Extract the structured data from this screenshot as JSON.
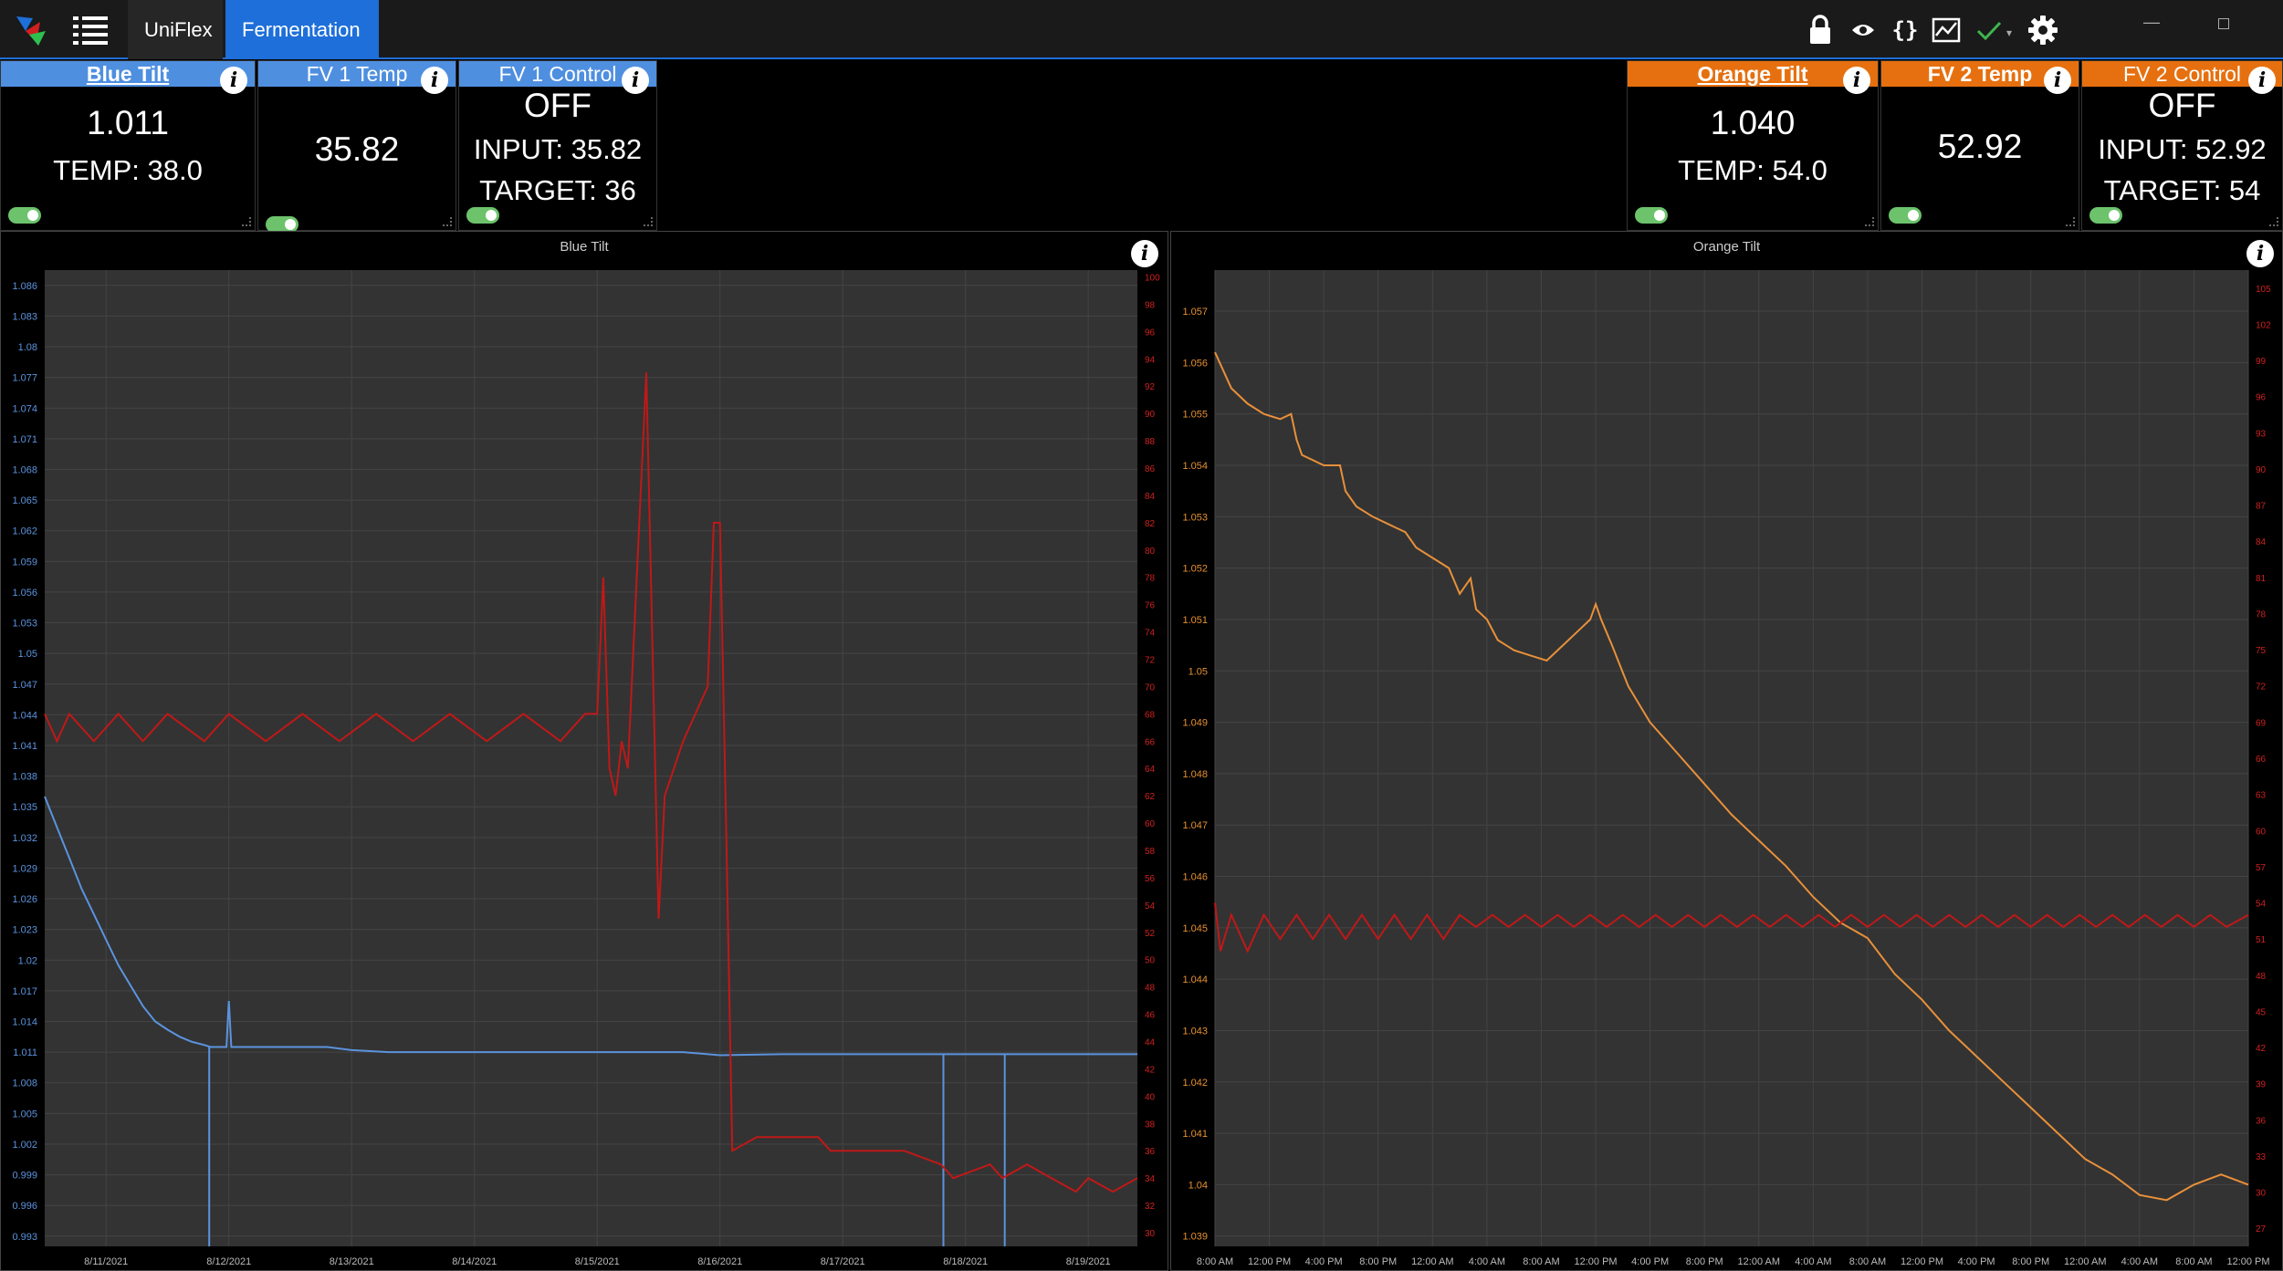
{
  "titlebar": {
    "tabs": [
      {
        "label": "UniFlex",
        "active": false
      },
      {
        "label": "Fermentation",
        "active": true
      }
    ],
    "icons": [
      "lock-icon",
      "eye-icon",
      "braces-icon",
      "chart-icon",
      "check-icon",
      "gear-icon"
    ],
    "window_controls": [
      "minimize",
      "maximize"
    ]
  },
  "tiles": [
    {
      "title": "Blue Tilt",
      "value": "1.011",
      "line2": "TEMP: 38.0",
      "color": "#4f8fe0",
      "enabled": true
    },
    {
      "title": "FV 1 Temp",
      "value": "35.82",
      "color": "#4f8fe0",
      "enabled": true
    },
    {
      "title": "FV 1 Control",
      "value": "OFF",
      "line2": "INPUT: 35.82",
      "line3": "TARGET: 36",
      "color": "#4f8fe0",
      "enabled": true
    },
    {
      "title": "Orange Tilt",
      "value": "1.040",
      "line2": "TEMP: 54.0",
      "color": "#e6700f",
      "enabled": true
    },
    {
      "title": "FV 2 Temp",
      "value": "52.92",
      "color": "#e6700f",
      "enabled": true
    },
    {
      "title": "FV 2 Control",
      "value": "OFF",
      "line2": "INPUT: 52.92",
      "line3": "TARGET: 54",
      "color": "#e6700f",
      "enabled": true
    }
  ],
  "chart_data": [
    {
      "type": "line",
      "title": "Blue Tilt",
      "x_tick_labels": [
        "8/11/2021",
        "8/12/2021",
        "8/13/2021",
        "8/14/2021",
        "8/15/2021",
        "8/16/2021",
        "8/17/2021",
        "8/18/2021",
        "8/19/2021"
      ],
      "y_left_ticks": [
        "1.086",
        "1.083",
        "1.08",
        "1.077",
        "1.074",
        "1.071",
        "1.068",
        "1.065",
        "1.062",
        "1.059",
        "1.056",
        "1.053",
        "1.05",
        "1.047",
        "1.044",
        "1.041",
        "1.038",
        "1.035",
        "1.032",
        "1.029",
        "1.026",
        "1.023",
        "1.02",
        "1.017",
        "1.014",
        "1.011",
        "1.008",
        "1.005",
        "1.002",
        "0.999",
        "0.996",
        "0.993"
      ],
      "y_right_ticks": [
        "100",
        "98",
        "96",
        "94",
        "92",
        "90",
        "88",
        "86",
        "84",
        "82",
        "80",
        "78",
        "76",
        "74",
        "72",
        "70",
        "68",
        "66",
        "64",
        "62",
        "60",
        "58",
        "56",
        "54",
        "52",
        "50",
        "48",
        "46",
        "44",
        "42",
        "40",
        "38",
        "36",
        "34",
        "32",
        "30"
      ],
      "ylim_left": [
        0.992,
        1.0875
      ],
      "ylim_right": [
        29,
        100.5
      ],
      "xlim": [
        10.5,
        19.4
      ],
      "grid": true,
      "series": [
        {
          "axis": "left",
          "color": "#5b93de",
          "points": [
            [
              10.5,
              1.036
            ],
            [
              10.6,
              1.033
            ],
            [
              10.7,
              1.03
            ],
            [
              10.8,
              1.027
            ],
            [
              10.9,
              1.0245
            ],
            [
              11.0,
              1.022
            ],
            [
              11.1,
              1.0195
            ],
            [
              11.2,
              1.0175
            ],
            [
              11.3,
              1.0155
            ],
            [
              11.4,
              1.014
            ],
            [
              11.5,
              1.0132
            ],
            [
              11.6,
              1.0125
            ],
            [
              11.7,
              1.012
            ],
            [
              11.8,
              1.0117
            ],
            [
              11.85,
              1.0115
            ],
            [
              11.9,
              1.0115
            ],
            [
              11.98,
              1.0115
            ],
            [
              12.0,
              1.016
            ],
            [
              12.02,
              1.0115
            ],
            [
              12.5,
              1.0115
            ],
            [
              12.8,
              1.0115
            ],
            [
              13.0,
              1.0112
            ],
            [
              13.3,
              1.011
            ],
            [
              14.0,
              1.011
            ],
            [
              15.0,
              1.011
            ],
            [
              15.7,
              1.011
            ],
            [
              16.0,
              1.0107
            ],
            [
              16.5,
              1.0108
            ],
            [
              17.0,
              1.0108
            ],
            [
              17.5,
              1.0108
            ],
            [
              18.0,
              1.0108
            ],
            [
              18.5,
              1.0108
            ],
            [
              19.0,
              1.0108
            ],
            [
              19.4,
              1.0108
            ]
          ]
        },
        {
          "axis": "left",
          "color": "#5b93de",
          "points": [
            [
              11.84,
              1.0115
            ],
            [
              11.84,
              0.992
            ]
          ]
        },
        {
          "axis": "left",
          "color": "#5b93de",
          "points": [
            [
              17.82,
              1.0108
            ],
            [
              17.82,
              0.992
            ]
          ]
        },
        {
          "axis": "left",
          "color": "#5b93de",
          "points": [
            [
              18.32,
              1.0108
            ],
            [
              18.32,
              0.992
            ]
          ]
        },
        {
          "axis": "right",
          "color": "#c01818",
          "points": [
            [
              10.5,
              68
            ],
            [
              10.6,
              66
            ],
            [
              10.7,
              68
            ],
            [
              10.9,
              66
            ],
            [
              11.1,
              68
            ],
            [
              11.3,
              66
            ],
            [
              11.5,
              68
            ],
            [
              11.8,
              66
            ],
            [
              12.0,
              68
            ],
            [
              12.3,
              66
            ],
            [
              12.6,
              68
            ],
            [
              12.9,
              66
            ],
            [
              13.2,
              68
            ],
            [
              13.5,
              66
            ],
            [
              13.8,
              68
            ],
            [
              14.1,
              66
            ],
            [
              14.4,
              68
            ],
            [
              14.7,
              66
            ],
            [
              14.9,
              68
            ],
            [
              15.0,
              68
            ],
            [
              15.05,
              78
            ],
            [
              15.1,
              64
            ],
            [
              15.15,
              62
            ],
            [
              15.2,
              66
            ],
            [
              15.25,
              64
            ],
            [
              15.4,
              93
            ],
            [
              15.5,
              53
            ],
            [
              15.55,
              62
            ],
            [
              15.7,
              66
            ],
            [
              15.8,
              68
            ],
            [
              15.9,
              70
            ],
            [
              15.95,
              82
            ],
            [
              16.0,
              82
            ],
            [
              16.05,
              60
            ],
            [
              16.1,
              36
            ],
            [
              16.3,
              37
            ],
            [
              16.6,
              37
            ],
            [
              16.8,
              37
            ],
            [
              16.9,
              36
            ],
            [
              17.2,
              36
            ],
            [
              17.5,
              36
            ],
            [
              17.8,
              35
            ],
            [
              17.9,
              34
            ],
            [
              18.2,
              35
            ],
            [
              18.3,
              34
            ],
            [
              18.5,
              35
            ],
            [
              18.7,
              34
            ],
            [
              18.9,
              33
            ],
            [
              19.0,
              34
            ],
            [
              19.2,
              33
            ],
            [
              19.4,
              34
            ]
          ]
        }
      ]
    },
    {
      "type": "line",
      "title": "Orange Tilt",
      "x_tick_labels": [
        "8:00 AM",
        "12:00 PM",
        "4:00 PM",
        "8:00 PM",
        "12:00 AM",
        "4:00 AM",
        "8:00 AM",
        "12:00 PM",
        "4:00 PM",
        "8:00 PM",
        "12:00 AM",
        "4:00 AM",
        "8:00 AM",
        "12:00 PM",
        "4:00 PM",
        "8:00 PM",
        "12:00 AM",
        "4:00 AM",
        "8:00 AM",
        "12:00 PM"
      ],
      "y_left_ticks": [
        "1.057",
        "1.056",
        "1.055",
        "1.054",
        "1.053",
        "1.052",
        "1.051",
        "1.05",
        "1.049",
        "1.048",
        "1.047",
        "1.046",
        "1.045",
        "1.044",
        "1.043",
        "1.042",
        "1.041",
        "1.04",
        "1.039"
      ],
      "y_right_ticks": [
        "105",
        "102",
        "99",
        "96",
        "93",
        "90",
        "87",
        "84",
        "81",
        "78",
        "75",
        "72",
        "69",
        "66",
        "63",
        "60",
        "57",
        "54",
        "51",
        "48",
        "45",
        "42",
        "39",
        "36",
        "33",
        "30",
        "27"
      ],
      "ylim_left": [
        1.0388,
        1.0578
      ],
      "ylim_right": [
        25.5,
        106.5
      ],
      "xlim": [
        0,
        19
      ],
      "grid": true,
      "series": [
        {
          "axis": "left",
          "color": "#e8903a",
          "points": [
            [
              0,
              1.0562
            ],
            [
              0.3,
              1.0555
            ],
            [
              0.6,
              1.0552
            ],
            [
              0.9,
              1.055
            ],
            [
              1.2,
              1.0549
            ],
            [
              1.4,
              1.055
            ],
            [
              1.5,
              1.0545
            ],
            [
              1.6,
              1.0542
            ],
            [
              2.0,
              1.054
            ],
            [
              2.3,
              1.054
            ],
            [
              2.4,
              1.0535
            ],
            [
              2.6,
              1.0532
            ],
            [
              2.9,
              1.053
            ],
            [
              3.3,
              1.0528
            ],
            [
              3.5,
              1.0527
            ],
            [
              3.7,
              1.0524
            ],
            [
              4.0,
              1.0522
            ],
            [
              4.3,
              1.052
            ],
            [
              4.5,
              1.0515
            ],
            [
              4.7,
              1.0518
            ],
            [
              4.8,
              1.0512
            ],
            [
              5.0,
              1.051
            ],
            [
              5.2,
              1.0506
            ],
            [
              5.5,
              1.0504
            ],
            [
              5.8,
              1.0503
            ],
            [
              6.1,
              1.0502
            ],
            [
              6.4,
              1.0505
            ],
            [
              6.7,
              1.0508
            ],
            [
              6.9,
              1.051
            ],
            [
              7.0,
              1.0513
            ],
            [
              7.1,
              1.051
            ],
            [
              7.3,
              1.0505
            ],
            [
              7.6,
              1.0497
            ],
            [
              8.0,
              1.049
            ],
            [
              8.5,
              1.0484
            ],
            [
              9.0,
              1.0478
            ],
            [
              9.5,
              1.0472
            ],
            [
              10.0,
              1.0467
            ],
            [
              10.5,
              1.0462
            ],
            [
              11.0,
              1.0456
            ],
            [
              11.5,
              1.0451
            ],
            [
              12.0,
              1.0448
            ],
            [
              12.5,
              1.0441
            ],
            [
              13.0,
              1.0436
            ],
            [
              13.5,
              1.043
            ],
            [
              14.0,
              1.0425
            ],
            [
              14.5,
              1.042
            ],
            [
              15.0,
              1.0415
            ],
            [
              15.5,
              1.041
            ],
            [
              16.0,
              1.0405
            ],
            [
              16.5,
              1.0402
            ],
            [
              17.0,
              1.0398
            ],
            [
              17.5,
              1.0397
            ],
            [
              18.0,
              1.04
            ],
            [
              18.5,
              1.0402
            ],
            [
              19.0,
              1.04
            ]
          ]
        },
        {
          "axis": "right",
          "color": "#c01818",
          "points": [
            [
              0,
              54
            ],
            [
              0.1,
              50
            ],
            [
              0.3,
              53
            ],
            [
              0.6,
              50
            ],
            [
              0.9,
              53
            ],
            [
              1.2,
              51
            ],
            [
              1.5,
              53
            ],
            [
              1.8,
              51
            ],
            [
              2.1,
              53
            ],
            [
              2.4,
              51
            ],
            [
              2.7,
              53
            ],
            [
              3.0,
              51
            ],
            [
              3.3,
              53
            ],
            [
              3.6,
              51
            ],
            [
              3.9,
              53
            ],
            [
              4.2,
              51
            ],
            [
              4.5,
              53
            ],
            [
              4.8,
              52
            ],
            [
              5.1,
              53
            ],
            [
              5.4,
              52
            ],
            [
              5.7,
              53
            ],
            [
              6.0,
              52
            ],
            [
              6.3,
              53
            ],
            [
              6.6,
              52
            ],
            [
              6.9,
              53
            ],
            [
              7.2,
              52
            ],
            [
              7.5,
              53
            ],
            [
              7.8,
              52
            ],
            [
              8.1,
              53
            ],
            [
              8.4,
              52
            ],
            [
              8.7,
              53
            ],
            [
              9.0,
              52
            ],
            [
              9.3,
              53
            ],
            [
              9.6,
              52
            ],
            [
              9.9,
              53
            ],
            [
              10.2,
              52
            ],
            [
              10.5,
              53
            ],
            [
              10.8,
              52
            ],
            [
              11.1,
              53
            ],
            [
              11.4,
              52
            ],
            [
              11.7,
              53
            ],
            [
              12.0,
              52
            ],
            [
              12.3,
              53
            ],
            [
              12.6,
              52
            ],
            [
              12.9,
              53
            ],
            [
              13.2,
              52
            ],
            [
              13.5,
              53
            ],
            [
              13.8,
              52
            ],
            [
              14.1,
              53
            ],
            [
              14.4,
              52
            ],
            [
              14.7,
              53
            ],
            [
              15.0,
              52
            ],
            [
              15.3,
              53
            ],
            [
              15.6,
              52
            ],
            [
              15.9,
              53
            ],
            [
              16.2,
              52
            ],
            [
              16.5,
              53
            ],
            [
              16.8,
              52
            ],
            [
              17.1,
              53
            ],
            [
              17.4,
              52
            ],
            [
              17.7,
              53
            ],
            [
              18.0,
              52
            ],
            [
              18.3,
              53
            ],
            [
              18.6,
              52
            ],
            [
              19.0,
              53
            ]
          ]
        }
      ]
    }
  ]
}
